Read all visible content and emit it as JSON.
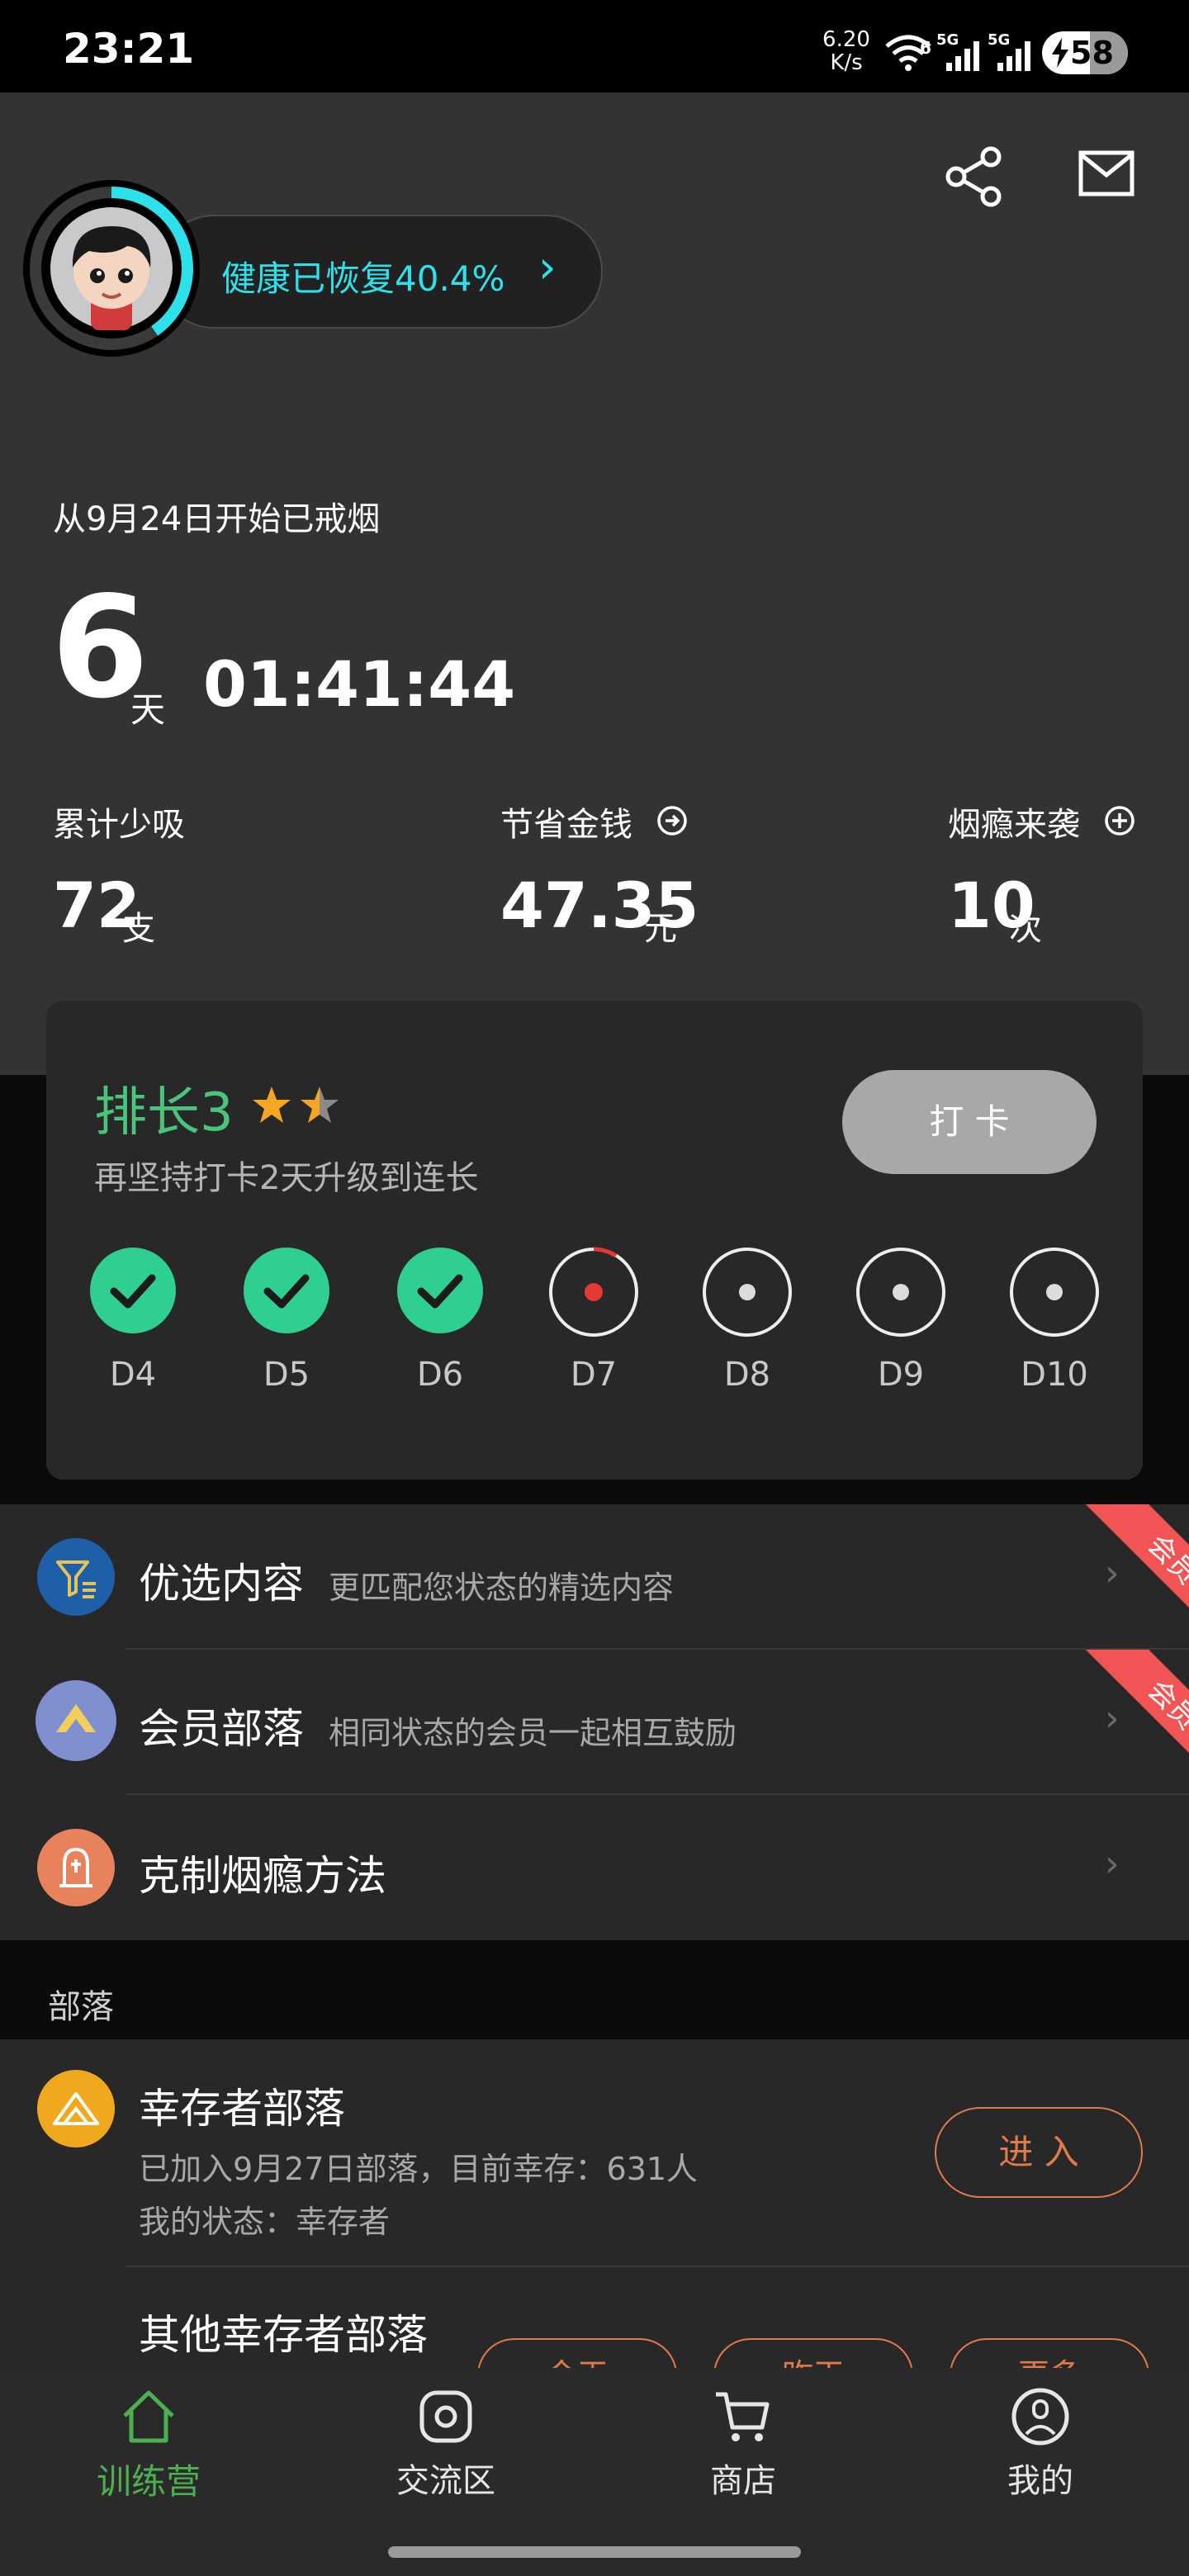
{
  "status_bar": {
    "time": "23:21",
    "net_speed_value": "6.20",
    "net_speed_unit": "K/s",
    "wifi_label": "6",
    "sim1": "5G",
    "sim2": "5G",
    "battery": "58"
  },
  "header": {
    "health_text": "健康已恢复40.4%",
    "health_chevron": "›",
    "health_progress": 0.404
  },
  "quit": {
    "since_text": "从9月24日开始已戒烟",
    "days": "6",
    "days_unit": "天",
    "time": "01:41:44"
  },
  "stats": [
    {
      "label": "累计少吸",
      "value": "72",
      "unit": "支"
    },
    {
      "label": "节省金钱",
      "value": "47.35",
      "unit": "元"
    },
    {
      "label": "烟瘾来袭",
      "value": "10",
      "unit": "次"
    }
  ],
  "rank": {
    "title": "排长3",
    "subtitle": "再坚持打卡2天升级到连长",
    "checkin_button": "打 卡",
    "stars": 1.5,
    "days": [
      {
        "label": "D4",
        "state": "done"
      },
      {
        "label": "D5",
        "state": "done"
      },
      {
        "label": "D6",
        "state": "done"
      },
      {
        "label": "D7",
        "state": "current"
      },
      {
        "label": "D8",
        "state": "pending"
      },
      {
        "label": "D9",
        "state": "pending"
      },
      {
        "label": "D10",
        "state": "pending"
      }
    ]
  },
  "menu": [
    {
      "title": "优选内容",
      "desc": "更匹配您状态的精选内容",
      "ribbon": "会员",
      "icon": "filter-icon",
      "icon_color": "#1e5fa8"
    },
    {
      "title": "会员部落",
      "desc": "相同状态的会员一起相互鼓励",
      "ribbon": "会员",
      "icon": "tribe-icon",
      "icon_color": "#7f8fcf"
    },
    {
      "title": "克制烟瘾方法",
      "desc": "",
      "ribbon": "",
      "icon": "method-icon",
      "icon_color": "#e8825c"
    }
  ],
  "tribe_section": {
    "header": "部落",
    "my_tribe": {
      "name": "幸存者部落",
      "info": "已加入9月27日部落，目前幸存：631人",
      "status": "我的状态：幸存者",
      "enter_button": "进 入"
    },
    "other_title": "其他幸存者部落",
    "other_buttons": [
      "今天",
      "昨天",
      "更多"
    ]
  },
  "tabs": [
    {
      "label": "训练营",
      "icon": "home-icon",
      "active": true
    },
    {
      "label": "交流区",
      "icon": "camera-icon",
      "active": false
    },
    {
      "label": "商店",
      "icon": "cart-icon",
      "active": false
    },
    {
      "label": "我的",
      "icon": "profile-icon",
      "active": false
    }
  ],
  "colors": {
    "accent_green": "#4caf50",
    "rank_green": "#49c47a",
    "check_green": "#2ecf91",
    "cyan": "#2ee0ea",
    "ribbon_red": "#f05454",
    "orange": "#e07a4a"
  }
}
